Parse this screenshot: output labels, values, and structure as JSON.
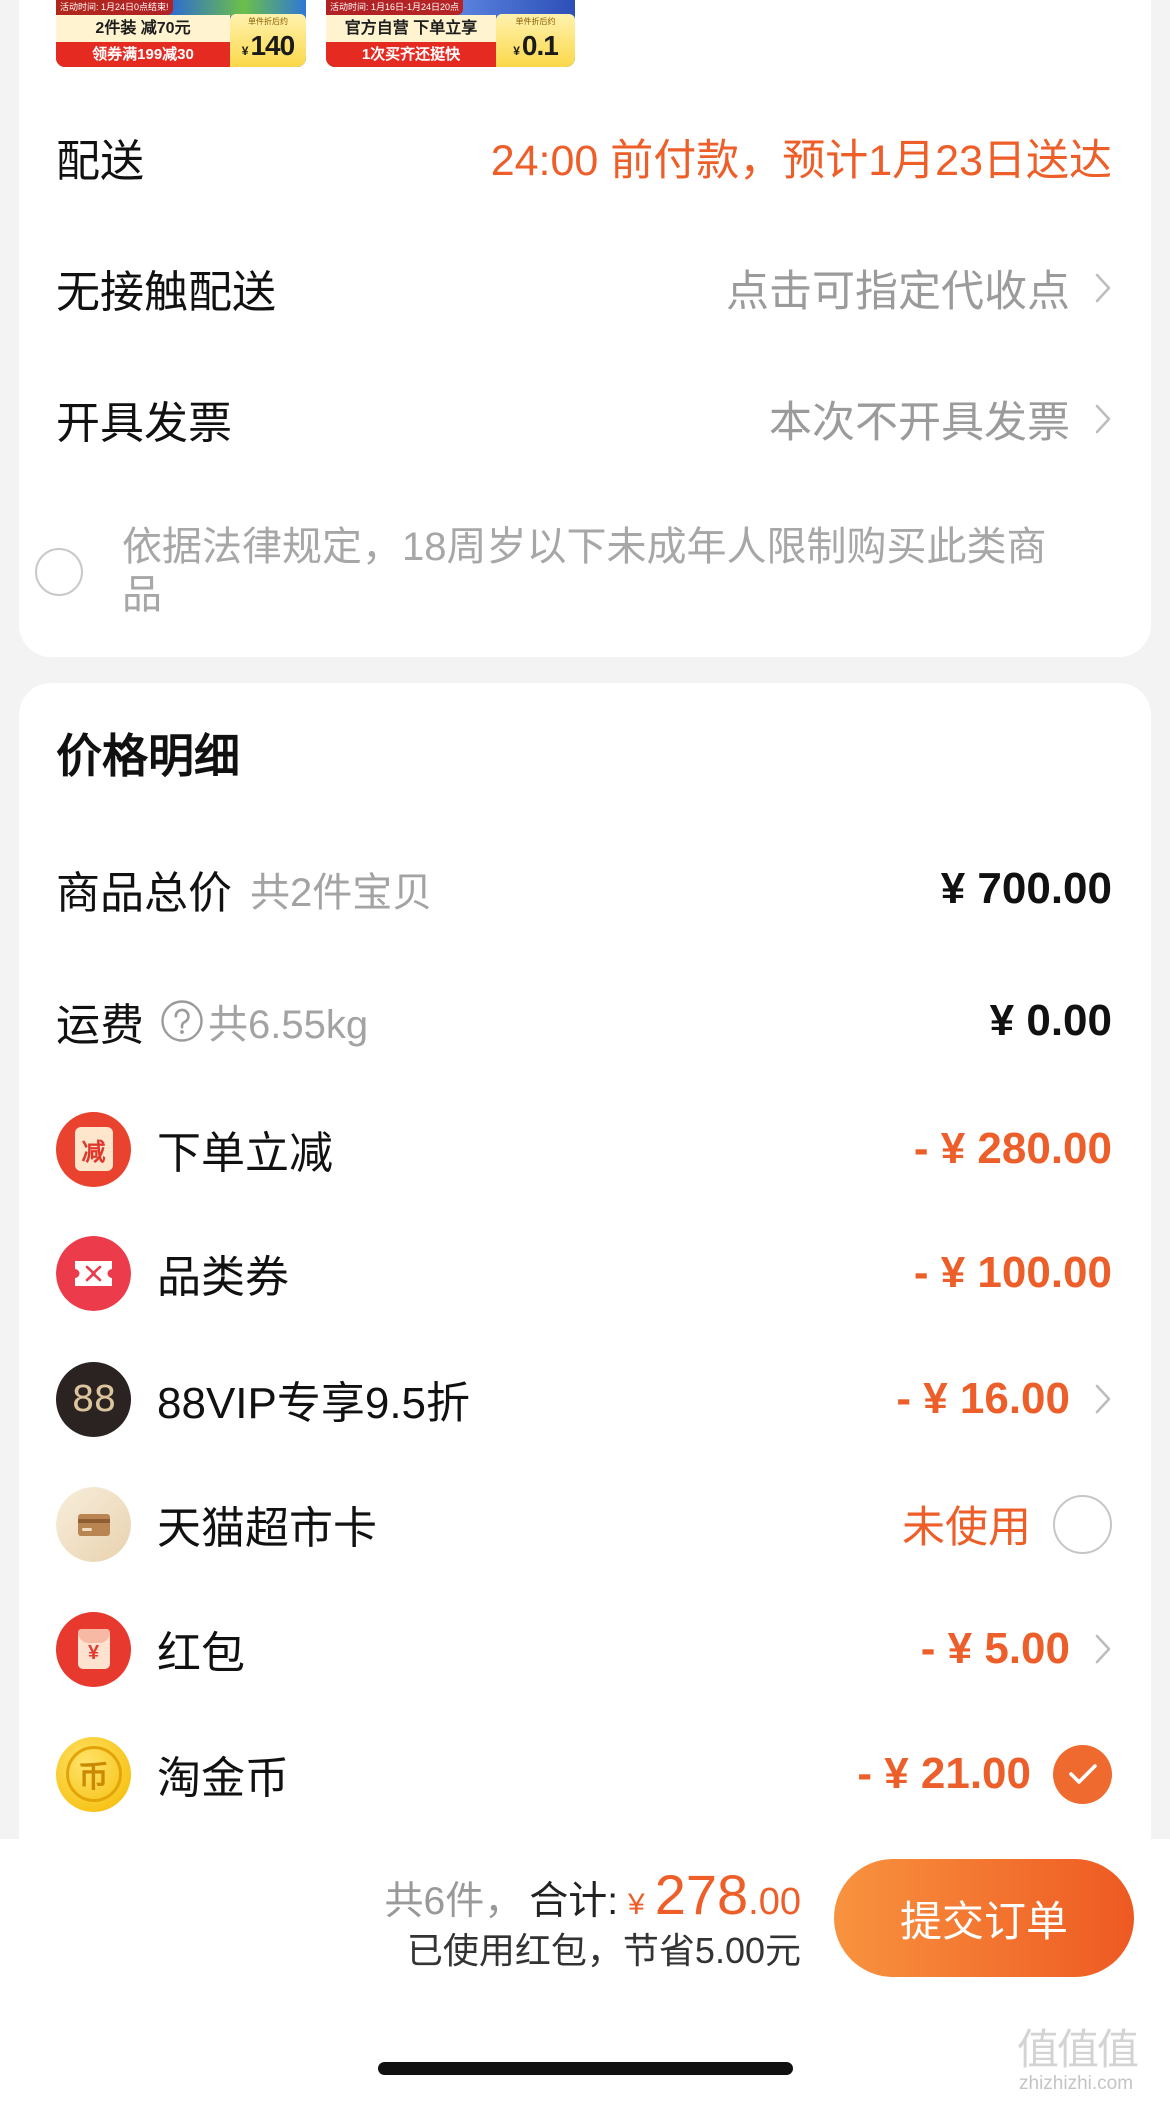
{
  "colors": {
    "accent": "#ee5e29",
    "muted": "#9b9b9b",
    "text": "#111111",
    "submit_gradient_from": "#f8933f",
    "submit_gradient_to": "#ee5922",
    "checked": "#ef6a2f"
  },
  "products": [
    {
      "activity": "活动时间: 1月24日0点结束!",
      "headline": "2件装 减70元",
      "promo": "领券满199减30",
      "price_note": "单件折后约",
      "currency": "¥",
      "price": "140"
    },
    {
      "activity": "活动时间: 1月16日-1月24日20点",
      "headline": "官方自营 下单立享",
      "promo": "1次买齐还挺快",
      "price_note": "单件折后约",
      "currency": "¥",
      "price": "0.1"
    }
  ],
  "order_info": {
    "delivery": {
      "label": "配送",
      "value": "24:00 前付款，预计1月23日送达"
    },
    "contactless": {
      "label": "无接触配送",
      "value": "点击可指定代收点",
      "icon": "chevron-right-icon"
    },
    "invoice": {
      "label": "开具发票",
      "value": "本次不开具发票",
      "icon": "chevron-right-icon"
    },
    "age_notice": {
      "text": "依据法律规定，18周岁以下未成年人限制购买此类商品",
      "checked": false
    }
  },
  "price_detail": {
    "title": "价格明细",
    "subtotal": {
      "label": "商品总价",
      "note": "共2件宝贝",
      "value": "¥ 700.00"
    },
    "shipping": {
      "label": "运费",
      "note": "共6.55kg",
      "value": "¥ 0.00",
      "icon": "help-icon"
    },
    "discounts": [
      {
        "icon": "instant-reduce-icon",
        "icon_text": "减",
        "label": "下单立减",
        "value": "- ¥ 280.00"
      },
      {
        "icon": "category-coupon-icon",
        "label": "品类券",
        "value": "- ¥ 100.00"
      },
      {
        "icon": "88vip-icon",
        "icon_text": "88",
        "label": "88VIP专享9.5折",
        "value": "- ¥ 16.00",
        "control": "chevron-right-icon"
      },
      {
        "icon": "supermarket-card-icon",
        "label": "天猫超市卡",
        "value": "未使用",
        "control": "radio",
        "checked": false
      },
      {
        "icon": "red-packet-icon",
        "icon_text": "¥",
        "label": "红包",
        "value": "- ¥ 5.00",
        "control": "chevron-right-icon"
      },
      {
        "icon": "taojinbi-coin-icon",
        "icon_text": "币",
        "label": "淘金币",
        "value": "- ¥ 21.00",
        "control": "checkbox",
        "checked": true
      }
    ]
  },
  "footer": {
    "count": "共6件，",
    "total_label": "合计:",
    "currency": "¥",
    "total_integer": "278",
    "total_decimal": ".00",
    "savings": "已使用红包，节省5.00元",
    "submit_label": "提交订单"
  },
  "watermark": {
    "logo": "值值值",
    "site": "zhizhizhi.com"
  }
}
